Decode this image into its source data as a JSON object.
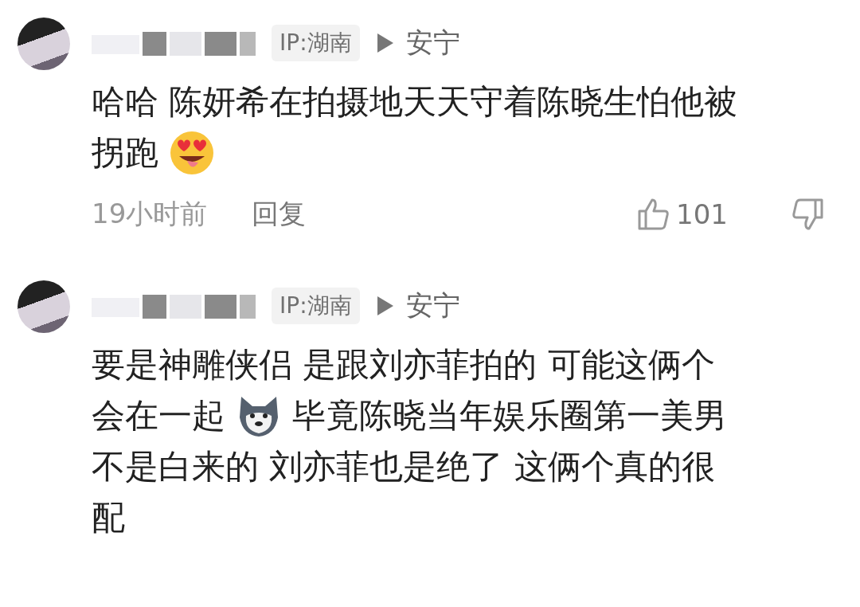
{
  "comments": [
    {
      "ip_badge": "IP:湖南",
      "location": "安宁",
      "lines": [
        [
          {
            "kind": "text",
            "text": "哈哈 陈妍希在拍摄地天天守着陈晓生怕他被"
          }
        ],
        [
          {
            "kind": "text",
            "text": "拐跑"
          },
          {
            "kind": "emoji_heart_eyes"
          }
        ]
      ],
      "time": "19小时前",
      "reply": "回复",
      "likes": "101"
    },
    {
      "ip_badge": "IP:湖南",
      "location": "安宁",
      "lines": [
        [
          {
            "kind": "text",
            "text": "要是神雕侠侣 是跟刘亦菲拍的 可能这俩个"
          }
        ],
        [
          {
            "kind": "text",
            "text": "会在一起"
          },
          {
            "kind": "emoji_dog"
          },
          {
            "kind": "text",
            "text": "毕竟陈晓当年娱乐圈第一美男"
          }
        ],
        [
          {
            "kind": "text",
            "text": "不是白来的 刘亦菲也是绝了 这俩个真的很"
          }
        ],
        [
          {
            "kind": "text",
            "text": "配"
          }
        ]
      ]
    }
  ]
}
